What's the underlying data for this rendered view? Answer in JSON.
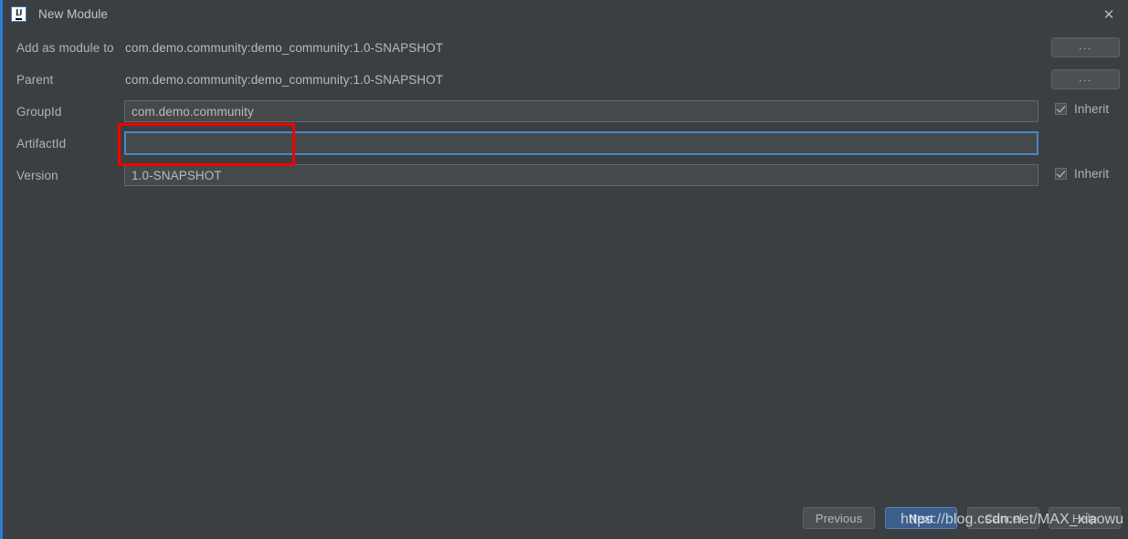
{
  "window": {
    "title": "New Module",
    "logo_text": "IJ",
    "close_icon": "close-icon"
  },
  "form": {
    "rows": [
      {
        "label": "Add as module to",
        "value": "com.demo.community:demo_community:1.0-SNAPSHOT",
        "type": "static",
        "browse": "..."
      },
      {
        "label": "Parent",
        "value": "com.demo.community:demo_community:1.0-SNAPSHOT",
        "type": "static",
        "browse": "..."
      },
      {
        "label": "GroupId",
        "value": "com.demo.community",
        "type": "input",
        "inherit": "Inherit",
        "inherit_checked": true
      },
      {
        "label": "ArtifactId",
        "value": "",
        "placeholder": "",
        "type": "input",
        "focused": true
      },
      {
        "label": "Version",
        "value": "1.0-SNAPSHOT",
        "type": "input",
        "inherit": "Inherit",
        "inherit_checked": true
      }
    ]
  },
  "buttons": {
    "previous": "Previous",
    "next": "Next",
    "cancel": "Cancel",
    "help": "Help"
  },
  "watermark": "https://blog.csdn.net/MAX_xiaowu",
  "colors": {
    "background": "#3c3f41",
    "field_background": "#45494a",
    "focus_border": "#4a87c4",
    "accent_button": "#3b5e8c",
    "annotation": "#f20000",
    "window_edge": "#2d7bd4"
  }
}
